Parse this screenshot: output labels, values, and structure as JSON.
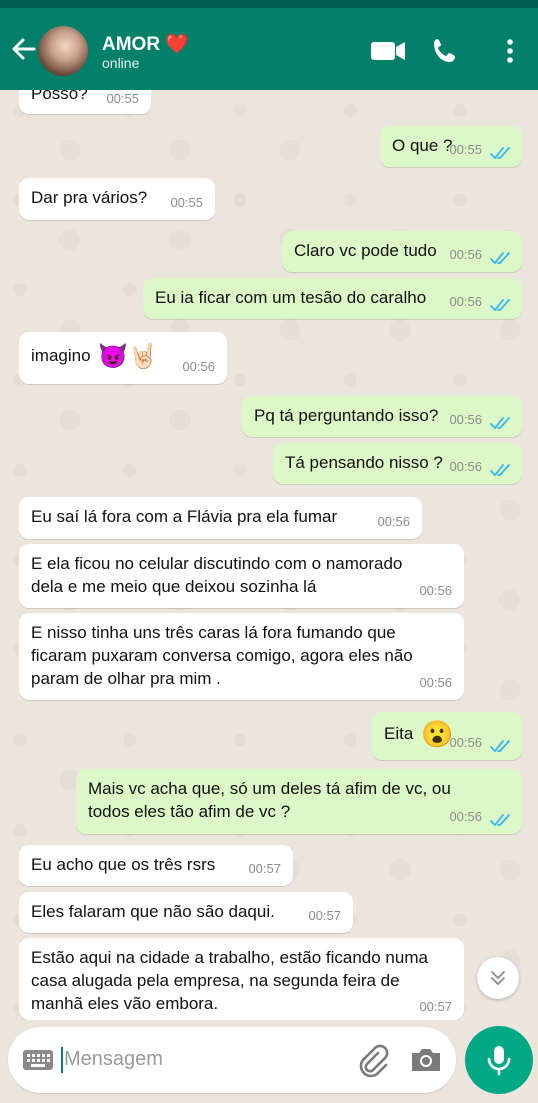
{
  "header": {
    "contact_name": "AMOR ❤️",
    "status": "online"
  },
  "messages": [
    {
      "dir": "in",
      "text": "Posso?",
      "time": "00:55"
    },
    {
      "dir": "out",
      "text": "O que ?",
      "time": "00:55"
    },
    {
      "dir": "in",
      "text": "Dar pra vários?",
      "time": "00:55"
    },
    {
      "dir": "out",
      "text": "Claro vc pode tudo",
      "time": "00:56"
    },
    {
      "dir": "out",
      "text": "Eu ia ficar com um tesão do caralho",
      "time": "00:56"
    },
    {
      "dir": "in",
      "text": "imagino",
      "emoji": "😈🤘🏻",
      "time": "00:56"
    },
    {
      "dir": "out",
      "text": "Pq tá perguntando isso?",
      "time": "00:56"
    },
    {
      "dir": "out",
      "text": "Tá pensando nisso ?",
      "time": "00:56"
    },
    {
      "dir": "in",
      "text": "Eu saí lá fora com a Flávia pra ela fumar",
      "time": "00:56"
    },
    {
      "dir": "in",
      "text": "E ela ficou no celular discutindo com o namorado dela e me meio que deixou sozinha lá",
      "time": "00:56"
    },
    {
      "dir": "in",
      "text": "E nisso tinha uns três caras lá fora fumando que ficaram puxaram conversa comigo, agora eles não param de olhar pra mim .",
      "time": "00:56"
    },
    {
      "dir": "out",
      "text": "Eita",
      "emoji": "😮",
      "time": "00:56"
    },
    {
      "dir": "out",
      "text": "Mais vc acha que, só um deles tá afim de vc, ou todos eles tão afim de vc ?",
      "time": "00:56"
    },
    {
      "dir": "in",
      "text": "Eu acho que os três rsrs",
      "time": "00:57"
    },
    {
      "dir": "in",
      "text": "Eles falaram que não são daqui.",
      "time": "00:57"
    },
    {
      "dir": "in",
      "text": "Estão aqui na cidade a trabalho, estão ficando numa casa alugada pela empresa, na segunda feira de manhã eles vão embora.",
      "time": "00:57"
    }
  ],
  "composer": {
    "placeholder": "Mensagem"
  },
  "colors": {
    "header": "#008069",
    "outgoing_bubble": "#dcf8c6",
    "incoming_bubble": "#ffffff",
    "read_ticks": "#34b7f1",
    "fab": "#00a884"
  }
}
